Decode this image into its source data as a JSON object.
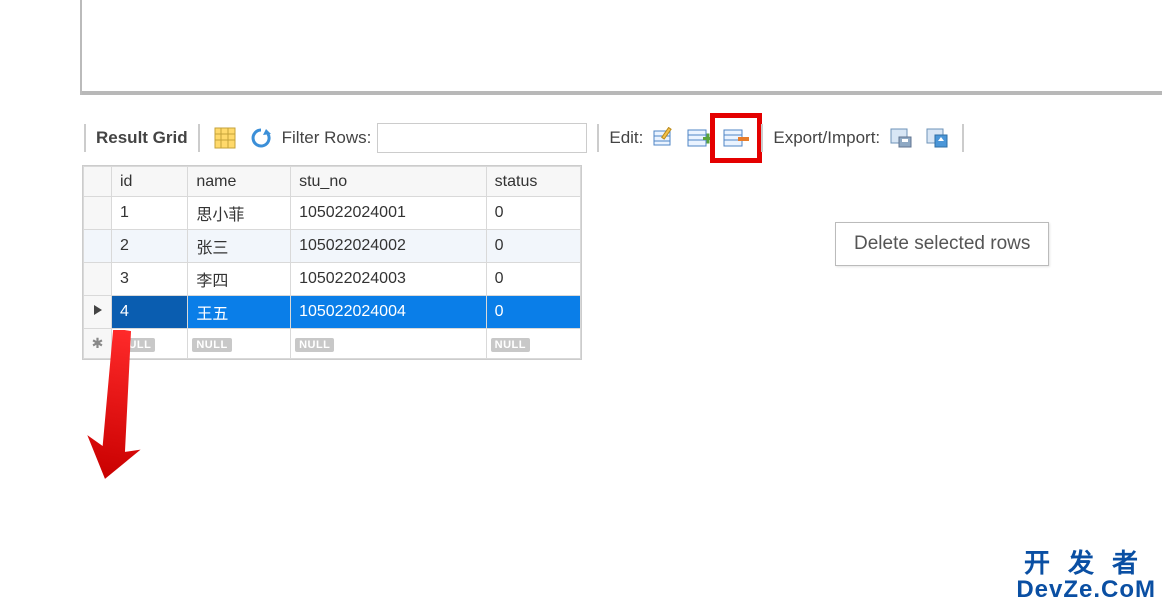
{
  "toolbar": {
    "result_grid_label": "Result Grid",
    "filter_label": "Filter Rows:",
    "filter_value": "",
    "edit_label": "Edit:",
    "export_label": "Export/Import:"
  },
  "tooltip": "Delete selected rows",
  "columns": [
    "id",
    "name",
    "stu_no",
    "status"
  ],
  "rows": [
    {
      "id": "1",
      "name": "思小菲",
      "stu_no": "105022024001",
      "status": "0",
      "selected": false,
      "alt": false
    },
    {
      "id": "2",
      "name": "张三",
      "stu_no": "105022024002",
      "status": "0",
      "selected": false,
      "alt": true
    },
    {
      "id": "3",
      "name": "李四",
      "stu_no": "105022024003",
      "status": "0",
      "selected": false,
      "alt": false
    },
    {
      "id": "4",
      "name": "王五",
      "stu_no": "105022024004",
      "status": "0",
      "selected": true,
      "alt": false
    }
  ],
  "null_label": "NULL",
  "watermark": {
    "line1": "开发者",
    "line2": "DevZe.CoM"
  }
}
